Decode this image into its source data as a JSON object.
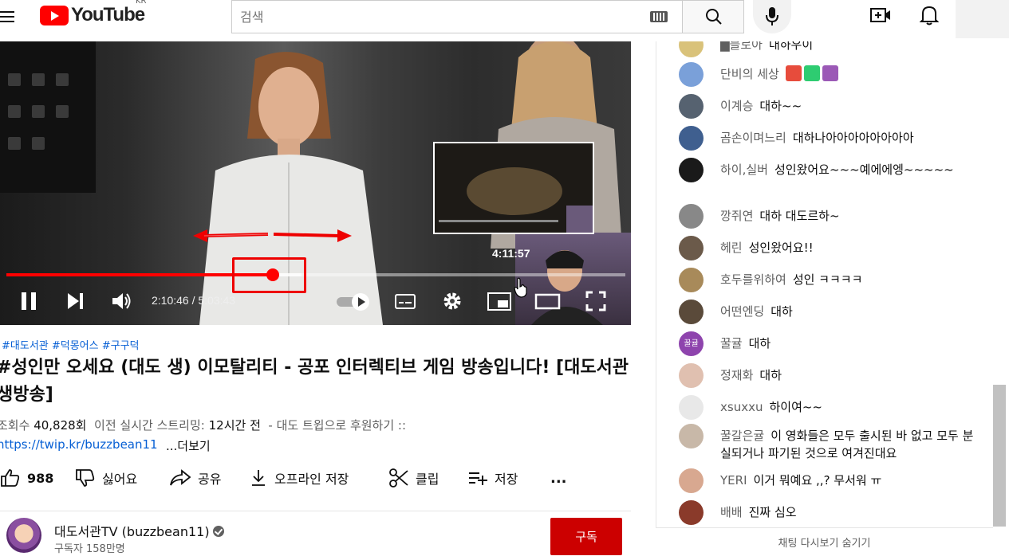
{
  "header": {
    "logo_text": "YouTube",
    "country_code": "KR",
    "search_placeholder": "검색",
    "search_value": ""
  },
  "player": {
    "preview_time": "4:11:57",
    "time_display": "2:10:46 / 5:03:43",
    "progress_fraction": 0.43,
    "icons": [
      "pause-icon",
      "next-icon",
      "volume-icon",
      "autoplay-toggle",
      "subtitles-icon",
      "settings-icon",
      "miniplayer-icon",
      "theater-icon",
      "fullscreen-icon"
    ]
  },
  "video": {
    "tags": "#대도서관 #덕몽어스 #구구덕",
    "title": "#성인만 오세요 (대도 생) 이모탈리티 - 공포 인터렉티브 게임 방송입니다! [대도서관 생방송]",
    "views_label": "조회수",
    "views_value": "40,828회",
    "stream_label": "이전 실시간 스트리밍:",
    "stream_value": "12시간 전",
    "description_snippet": "- 대도 트윕으로 후원하기 ::",
    "link": "https://twip.kr/buzzbean11",
    "more_label": "...더보기"
  },
  "actions": {
    "like_count": "988",
    "dislike_label": "싫어요",
    "share_label": "공유",
    "download_label": "오프라인 저장",
    "clip_label": "클립",
    "save_label": "저장",
    "more_label": "..."
  },
  "channel": {
    "name": "대도서관TV (buzzbean11)",
    "subscribers": "구독자 158만명",
    "subscribe_label": "구독"
  },
  "chat": {
    "messages": [
      {
        "author": "█블로아",
        "text": "대하우이",
        "avatar_color": "#d9c27a"
      },
      {
        "author": "단비의 세상",
        "text": "",
        "avatar_color": "#7aa0d9",
        "emojis": [
          "#e74c3c",
          "#2ecc71",
          "#9b59b6"
        ]
      },
      {
        "author": "이계승",
        "text": "대하~~",
        "avatar_color": "#566270"
      },
      {
        "author": "곰손이며느리",
        "text": "대하나아아아아아아아아",
        "avatar_color": "#3f5f8f"
      },
      {
        "author": "하이,실버",
        "text": "성인왔어요~~~예에에엥~~~~~",
        "avatar_color": "#1a1a1a"
      },
      {
        "author": "깡쥐연",
        "text": "대하 대도르하~",
        "avatar_color": "#888"
      },
      {
        "author": "헤린",
        "text": "성인왔어요!!",
        "avatar_color": "#6b5a4a"
      },
      {
        "author": "호두를위하여",
        "text": "성인 ㅋㅋㅋㅋ",
        "avatar_color": "#a88a5a"
      },
      {
        "author": "어떤엔딩",
        "text": "대하",
        "avatar_color": "#5a4a3a"
      },
      {
        "author": "꿀귤",
        "text": "대하",
        "avatar_color": "#8e44ad",
        "avatar_text": "꿀귤"
      },
      {
        "author": "정재화",
        "text": "대하",
        "avatar_color": "#e0c0b0"
      },
      {
        "author": "xsuxxu",
        "text": "하이여~~",
        "avatar_color": "#e8e8e8"
      },
      {
        "author": "꿀갈은귤",
        "text": "이 영화들은 모두 출시된 바 없고 모두 분실되거나 파기된 것으로 여겨진대요",
        "avatar_color": "#c8b8a8"
      },
      {
        "author": "YERI",
        "text": "이거 뭐예요 ,,? 무서워 ㅠ",
        "avatar_color": "#d8a890"
      },
      {
        "author": "배배",
        "text": "진짜 심오",
        "avatar_color": "#8a3a2a"
      }
    ],
    "footer_label": "채팅 다시보기 숨기기"
  }
}
